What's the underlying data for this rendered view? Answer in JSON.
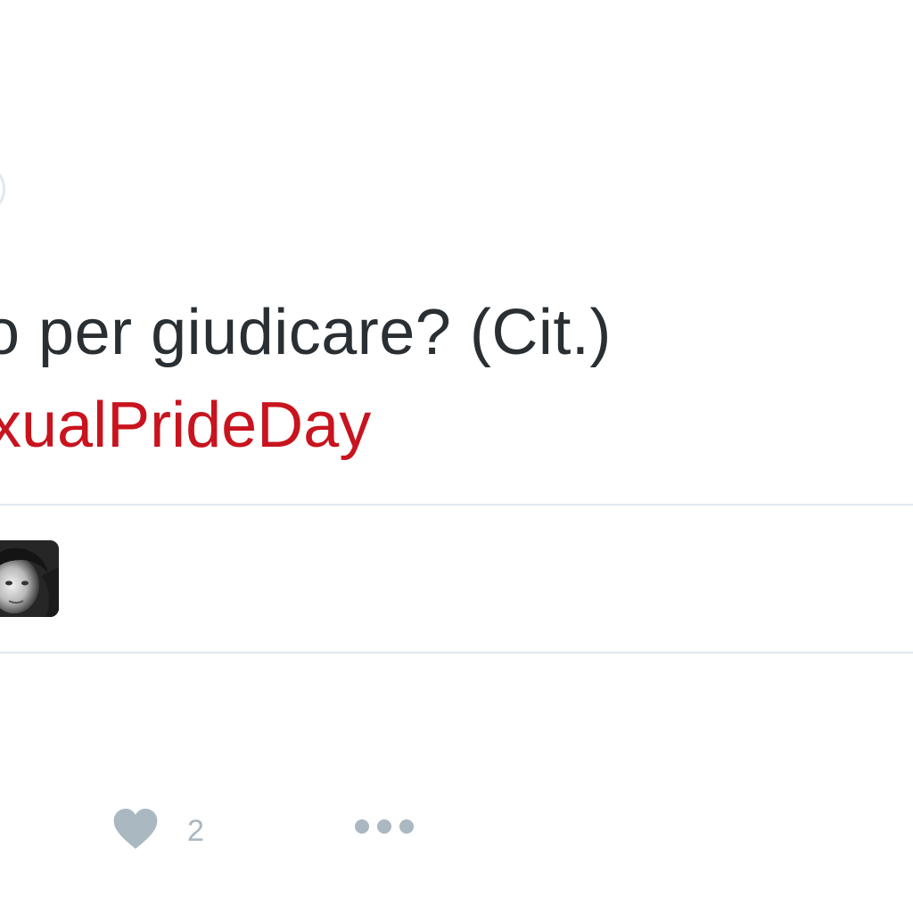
{
  "tweet": {
    "text_line": "o per giudicare? (Cit.)",
    "hashtag": "xualPrideDay"
  },
  "likers": {
    "avatar_icon": "user-avatar-photo"
  },
  "actions": {
    "like_icon": "heart-icon",
    "like_count": "2",
    "more_icon": "more-dots-icon"
  },
  "colors": {
    "text": "#292f33",
    "hashtag": "#c8141e",
    "divider": "#e1e8ed",
    "action_icon": "#aab8c2"
  }
}
